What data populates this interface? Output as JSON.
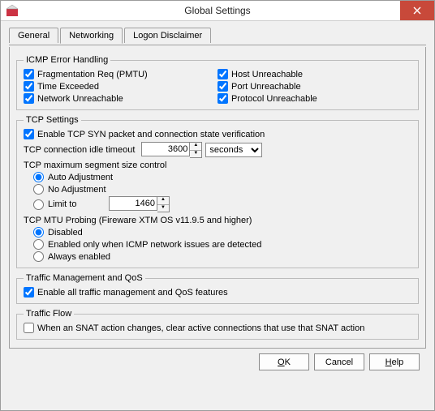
{
  "window": {
    "title": "Global Settings"
  },
  "tabs": {
    "general": "General",
    "networking": "Networking",
    "logon": "Logon Disclaimer"
  },
  "icmp": {
    "legend": "ICMP Error Handling",
    "frag": "Fragmentation Req (PMTU)",
    "time": "Time Exceeded",
    "net_unreach": "Network Unreachable",
    "host_unreach": "Host Unreachable",
    "port_unreach": "Port Unreachable",
    "proto_unreach": "Protocol Unreachable"
  },
  "tcp": {
    "legend": "TCP Settings",
    "enable_syn": "Enable TCP SYN packet and connection state verification",
    "idle_label": "TCP connection idle timeout",
    "idle_value": "3600",
    "idle_unit": "seconds",
    "mss_header": "TCP maximum segment size control",
    "mss_auto": "Auto Adjustment",
    "mss_no": "No Adjustment",
    "mss_limit": "Limit to",
    "mss_limit_value": "1460",
    "mtu_header": "TCP MTU Probing  (Fireware XTM OS v11.9.5 and higher)",
    "mtu_disabled": "Disabled",
    "mtu_icmp": "Enabled only when ICMP network issues are detected",
    "mtu_always": "Always enabled"
  },
  "qos": {
    "legend": "Traffic Management and QoS",
    "enable": "Enable all traffic management and QoS features"
  },
  "flow": {
    "legend": "Traffic Flow",
    "snat": "When an SNAT action changes, clear active connections that use that SNAT action"
  },
  "buttons": {
    "ok": "OK",
    "cancel": "Cancel",
    "help": "Help"
  }
}
